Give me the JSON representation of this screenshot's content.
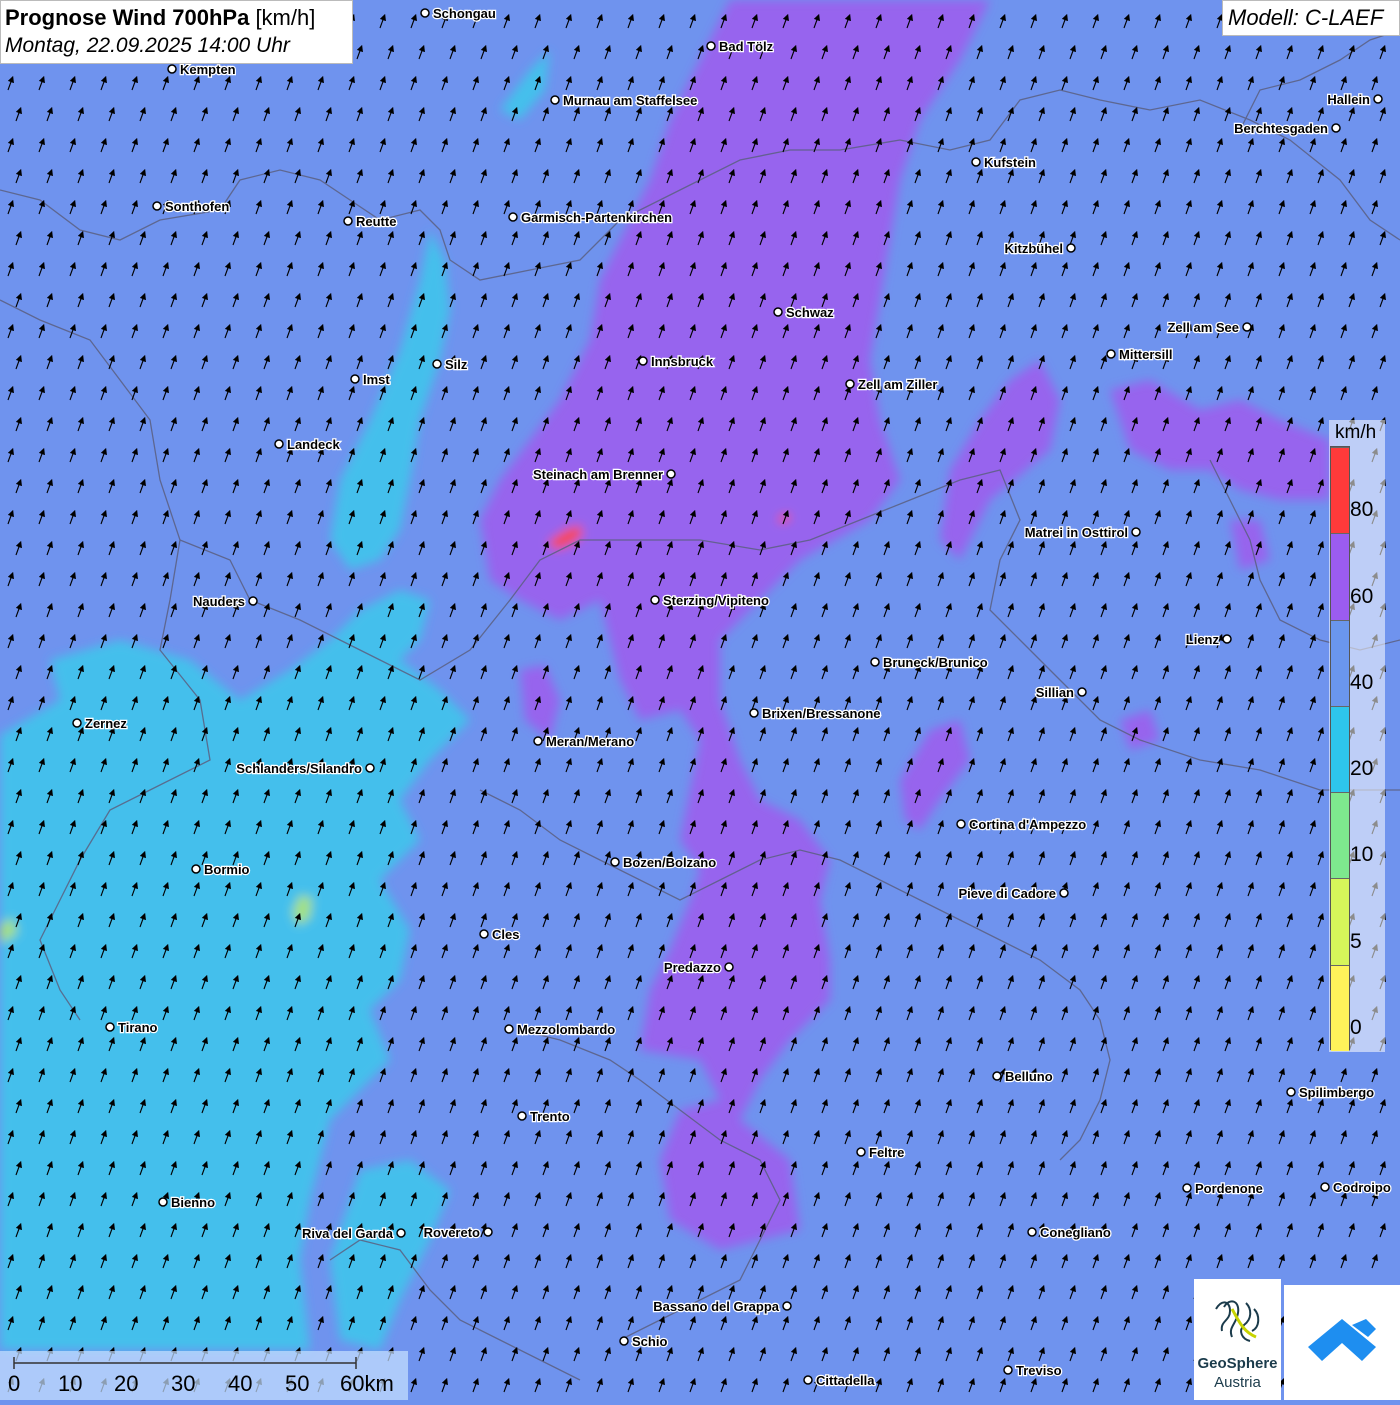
{
  "header": {
    "title_bold": "Prognose Wind 700hPa",
    "title_unit": "[km/h]",
    "datetime": "Montag, 22.09.2025 14:00 Uhr"
  },
  "model": "Modell: C-LAEF",
  "legend": {
    "unit": "km/h",
    "labels": [
      "80",
      "60",
      "40",
      "20",
      "10",
      "5",
      "0"
    ],
    "colors": [
      "#ff3a3a",
      "#9b5cf0",
      "#6a96ee",
      "#2ec6ec",
      "#7ee88e",
      "#d6f55a",
      "#fff35a"
    ]
  },
  "scalebar": {
    "labels": [
      "0",
      "10",
      "20",
      "30",
      "40",
      "50",
      "60km"
    ]
  },
  "logos": {
    "geosphere_name": "GeoSphere",
    "geosphere_sub": "Austria"
  },
  "palette": {
    "base": "#6f93ee",
    "cyan": "#42c2ec",
    "purple": "#9a62ee",
    "red": "#ff4545",
    "green": "#a8e67c",
    "border": "#5b5f80",
    "arrow": "#000000"
  },
  "cities": [
    {
      "name": "Schongau"
    },
    {
      "name": "Bad Tölz"
    },
    {
      "name": "Kempten"
    },
    {
      "name": "Murnau am Staffelsee"
    },
    {
      "name": "Hallein"
    },
    {
      "name": "Berchtesgaden"
    },
    {
      "name": "Kufstein"
    },
    {
      "name": "Sonthofen"
    },
    {
      "name": "Reutte"
    },
    {
      "name": "Garmisch-Partenkirchen"
    },
    {
      "name": "Kitzbühel"
    },
    {
      "name": "Schwaz"
    },
    {
      "name": "Zell am See"
    },
    {
      "name": "Innsbruck"
    },
    {
      "name": "Silz"
    },
    {
      "name": "Imst"
    },
    {
      "name": "Mittersill"
    },
    {
      "name": "Zell am Ziller"
    },
    {
      "name": "Landeck"
    },
    {
      "name": "Steinach am Brenner"
    },
    {
      "name": "Matrei in Osttirol"
    },
    {
      "name": "Nauders"
    },
    {
      "name": "Sterzing/Vipiteno"
    },
    {
      "name": "Lienz"
    },
    {
      "name": "Bruneck/Brunico"
    },
    {
      "name": "Sillian"
    },
    {
      "name": "Brixen/Bressanone"
    },
    {
      "name": "Zernez"
    },
    {
      "name": "Meran/Merano"
    },
    {
      "name": "Schlanders/Silandro"
    },
    {
      "name": "Cortina d'Ampezzo"
    },
    {
      "name": "Bozen/Bolzano"
    },
    {
      "name": "Bormio"
    },
    {
      "name": "Pieve di Cadore"
    },
    {
      "name": "Cles"
    },
    {
      "name": "Predazzo"
    },
    {
      "name": "Tirano"
    },
    {
      "name": "Mezzolombardo"
    },
    {
      "name": "Belluno"
    },
    {
      "name": "Spilimbergo"
    },
    {
      "name": "Trento"
    },
    {
      "name": "Feltre"
    },
    {
      "name": "Pordenone"
    },
    {
      "name": "Codroipo"
    },
    {
      "name": "Bienno"
    },
    {
      "name": "Riva del Garda"
    },
    {
      "name": "Rovereto"
    },
    {
      "name": "Conegliano"
    },
    {
      "name": "Bassano del Grappa"
    },
    {
      "name": "Schio"
    },
    {
      "name": "Treviso"
    },
    {
      "name": "Cittadella"
    }
  ]
}
